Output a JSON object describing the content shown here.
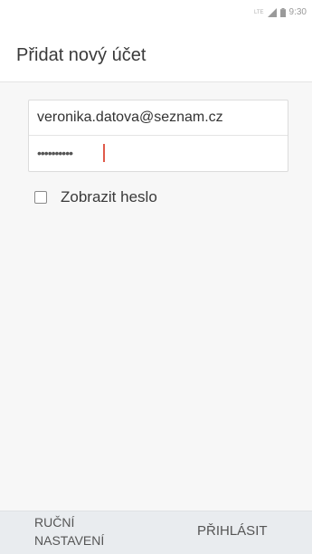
{
  "status_bar": {
    "network_label": "LTE",
    "time": "9:30",
    "icons": [
      "lte-icon",
      "signal-icon",
      "battery-icon"
    ]
  },
  "header": {
    "title": "Přidat nový účet"
  },
  "form": {
    "email_value": "veronika.datova@seznam.cz",
    "password_masked": "••••••••••",
    "show_password_label": "Zobrazit heslo",
    "show_password_checked": false
  },
  "footer": {
    "manual_setup_label": "RUČNÍ\nNASTAVENÍ",
    "login_label": "PŘIHLÁSIT"
  },
  "colors": {
    "cursor": "#e05a4a",
    "content_bg": "#f7f7f7",
    "footer_bg": "#e9ecef"
  }
}
